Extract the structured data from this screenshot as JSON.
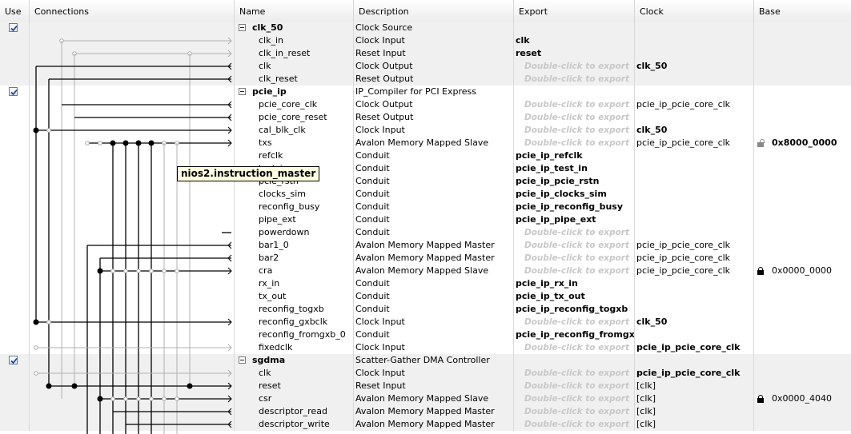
{
  "columns": {
    "use": "Use",
    "connections": "Connections",
    "name": "Name",
    "description": "Description",
    "export": "Export",
    "clock": "Clock",
    "base": "Base"
  },
  "tooltip": "nios2.instruction_master",
  "rows": [
    {
      "kind": "component",
      "name": "clk_50",
      "description": "Clock Source",
      "export": "",
      "clock": "",
      "base": "",
      "checked": true
    },
    {
      "kind": "port",
      "name": "clk_in",
      "description": "Clock Input",
      "export": "clk",
      "clock": "",
      "base": ""
    },
    {
      "kind": "port",
      "name": "clk_in_reset",
      "description": "Reset Input",
      "export": "reset",
      "clock": "",
      "base": ""
    },
    {
      "kind": "port",
      "name": "clk",
      "description": "Clock Output",
      "export": "Double-click to export",
      "clock": "clk_50",
      "base": ""
    },
    {
      "kind": "port",
      "name": "clk_reset",
      "description": "Reset Output",
      "export": "Double-click to export",
      "clock": "",
      "base": ""
    },
    {
      "kind": "component",
      "name": "pcie_ip",
      "description": "IP_Compiler for PCI Express",
      "export": "",
      "clock": "",
      "base": "",
      "checked": true
    },
    {
      "kind": "port",
      "name": "pcie_core_clk",
      "description": "Clock Output",
      "export": "Double-click to export",
      "clock": "pcie_ip_pcie_core_clk",
      "base": ""
    },
    {
      "kind": "port",
      "name": "pcie_core_reset",
      "description": "Reset Output",
      "export": "Double-click to export",
      "clock": "",
      "base": ""
    },
    {
      "kind": "port",
      "name": "cal_blk_clk",
      "description": "Clock Input",
      "export": "Double-click to export",
      "clock": "clk_50",
      "base": ""
    },
    {
      "kind": "port",
      "name": "txs",
      "description": "Avalon Memory Mapped Slave",
      "export": "Double-click to export",
      "clock": "pcie_ip_pcie_core_clk",
      "base": "0x8000_0000",
      "lock": "open"
    },
    {
      "kind": "port",
      "name": "refclk",
      "description": "Conduit",
      "export": "pcie_ip_refclk",
      "clock": "",
      "base": ""
    },
    {
      "kind": "port",
      "name": "test_in",
      "description": "Conduit",
      "export": "pcie_ip_test_in",
      "clock": "",
      "base": ""
    },
    {
      "kind": "port",
      "name": "pcie_rstn",
      "description": "Conduit",
      "export": "pcie_ip_pcie_rstn",
      "clock": "",
      "base": ""
    },
    {
      "kind": "port",
      "name": "clocks_sim",
      "description": "Conduit",
      "export": "pcie_ip_clocks_sim",
      "clock": "",
      "base": ""
    },
    {
      "kind": "port",
      "name": "reconfig_busy",
      "description": "Conduit",
      "export": "pcie_ip_reconfig_busy",
      "clock": "",
      "base": ""
    },
    {
      "kind": "port",
      "name": "pipe_ext",
      "description": "Conduit",
      "export": "pcie_ip_pipe_ext",
      "clock": "",
      "base": ""
    },
    {
      "kind": "port",
      "name": "powerdown",
      "description": "Conduit",
      "export": "Double-click to export",
      "clock": "",
      "base": ""
    },
    {
      "kind": "port",
      "name": "bar1_0",
      "description": "Avalon Memory Mapped Master",
      "export": "Double-click to export",
      "clock": "pcie_ip_pcie_core_clk",
      "base": ""
    },
    {
      "kind": "port",
      "name": "bar2",
      "description": "Avalon Memory Mapped Master",
      "export": "Double-click to export",
      "clock": "pcie_ip_pcie_core_clk",
      "base": ""
    },
    {
      "kind": "port",
      "name": "cra",
      "description": "Avalon Memory Mapped Slave",
      "export": "Double-click to export",
      "clock": "pcie_ip_pcie_core_clk",
      "base": "0x0000_0000",
      "lock": "closed"
    },
    {
      "kind": "port",
      "name": "rx_in",
      "description": "Conduit",
      "export": "pcie_ip_rx_in",
      "clock": "",
      "base": ""
    },
    {
      "kind": "port",
      "name": "tx_out",
      "description": "Conduit",
      "export": "pcie_ip_tx_out",
      "clock": "",
      "base": ""
    },
    {
      "kind": "port",
      "name": "reconfig_togxb",
      "description": "Conduit",
      "export": "pcie_ip_reconfig_togxb",
      "clock": "",
      "base": ""
    },
    {
      "kind": "port",
      "name": "reconfig_gxbclk",
      "description": "Clock Input",
      "export": "Double-click to export",
      "clock": "clk_50",
      "base": ""
    },
    {
      "kind": "port",
      "name": "reconfig_fromgxb_0",
      "description": "Conduit",
      "export": "pcie_ip_reconfig_fromgx...",
      "clock": "",
      "base": ""
    },
    {
      "kind": "port",
      "name": "fixedclk",
      "description": "Clock Input",
      "export": "Double-click to export",
      "clock": "pcie_ip_pcie_core_clk",
      "base": ""
    },
    {
      "kind": "component",
      "name": "sgdma",
      "description": "Scatter-Gather DMA Controller",
      "export": "",
      "clock": "",
      "base": "",
      "checked": true
    },
    {
      "kind": "port",
      "name": "clk",
      "description": "Clock Input",
      "export": "Double-click to export",
      "clock": "pcie_ip_pcie_core_clk",
      "base": ""
    },
    {
      "kind": "port",
      "name": "reset",
      "description": "Reset Input",
      "export": "Double-click to export",
      "clock": "[clk]",
      "base": ""
    },
    {
      "kind": "port",
      "name": "csr",
      "description": "Avalon Memory Mapped Slave",
      "export": "Double-click to export",
      "clock": "[clk]",
      "base": "0x0000_4040",
      "lock": "closed"
    },
    {
      "kind": "port",
      "name": "descriptor_read",
      "description": "Avalon Memory Mapped Master",
      "export": "Double-click to export",
      "clock": "[clk]",
      "base": ""
    },
    {
      "kind": "port",
      "name": "descriptor_write",
      "description": "Avalon Memory Mapped Master",
      "export": "Double-click to export",
      "clock": "[clk]",
      "base": ""
    }
  ]
}
